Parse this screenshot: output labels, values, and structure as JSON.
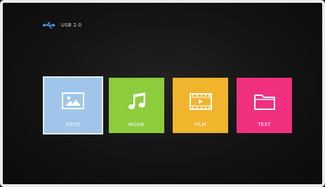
{
  "status": {
    "icon": "usb-icon",
    "label": "USB 2.0"
  },
  "tiles": [
    {
      "label": "FOTO",
      "icon": "photo-icon",
      "color": "#9fc6ea",
      "selected": true
    },
    {
      "label": "MUSIK",
      "icon": "music-icon",
      "color": "#8ccc3d",
      "selected": false
    },
    {
      "label": "FILM",
      "icon": "film-icon",
      "color": "#f0b52d",
      "selected": false
    },
    {
      "label": "TEXT",
      "icon": "folder-icon",
      "color": "#f0307f",
      "selected": false
    }
  ]
}
